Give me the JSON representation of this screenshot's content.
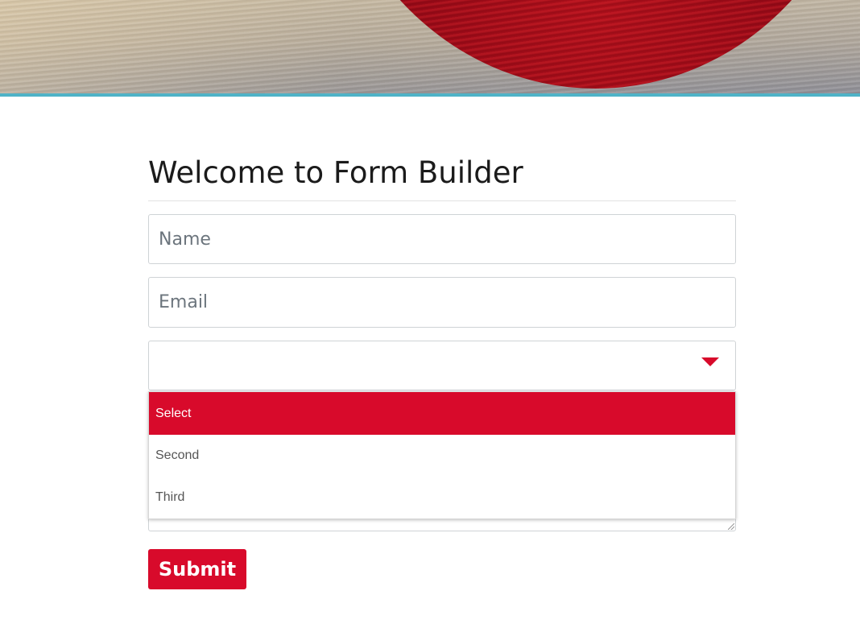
{
  "header": {
    "accent_color": "#4fb3c7"
  },
  "form": {
    "title": "Welcome to Form Builder",
    "name_placeholder": "Name",
    "email_placeholder": "Email",
    "select": {
      "options": [
        "Select",
        "Second",
        "Third"
      ],
      "highlighted_index": 0
    },
    "submit_label": "Submit"
  },
  "colors": {
    "brand": "#d80a2b",
    "text": "#1b1b1b",
    "placeholder": "#6c757d",
    "border": "#cfd3d6"
  },
  "icons": {
    "select_caret": "caret-down-icon",
    "resize": "resize-grip-icon"
  }
}
